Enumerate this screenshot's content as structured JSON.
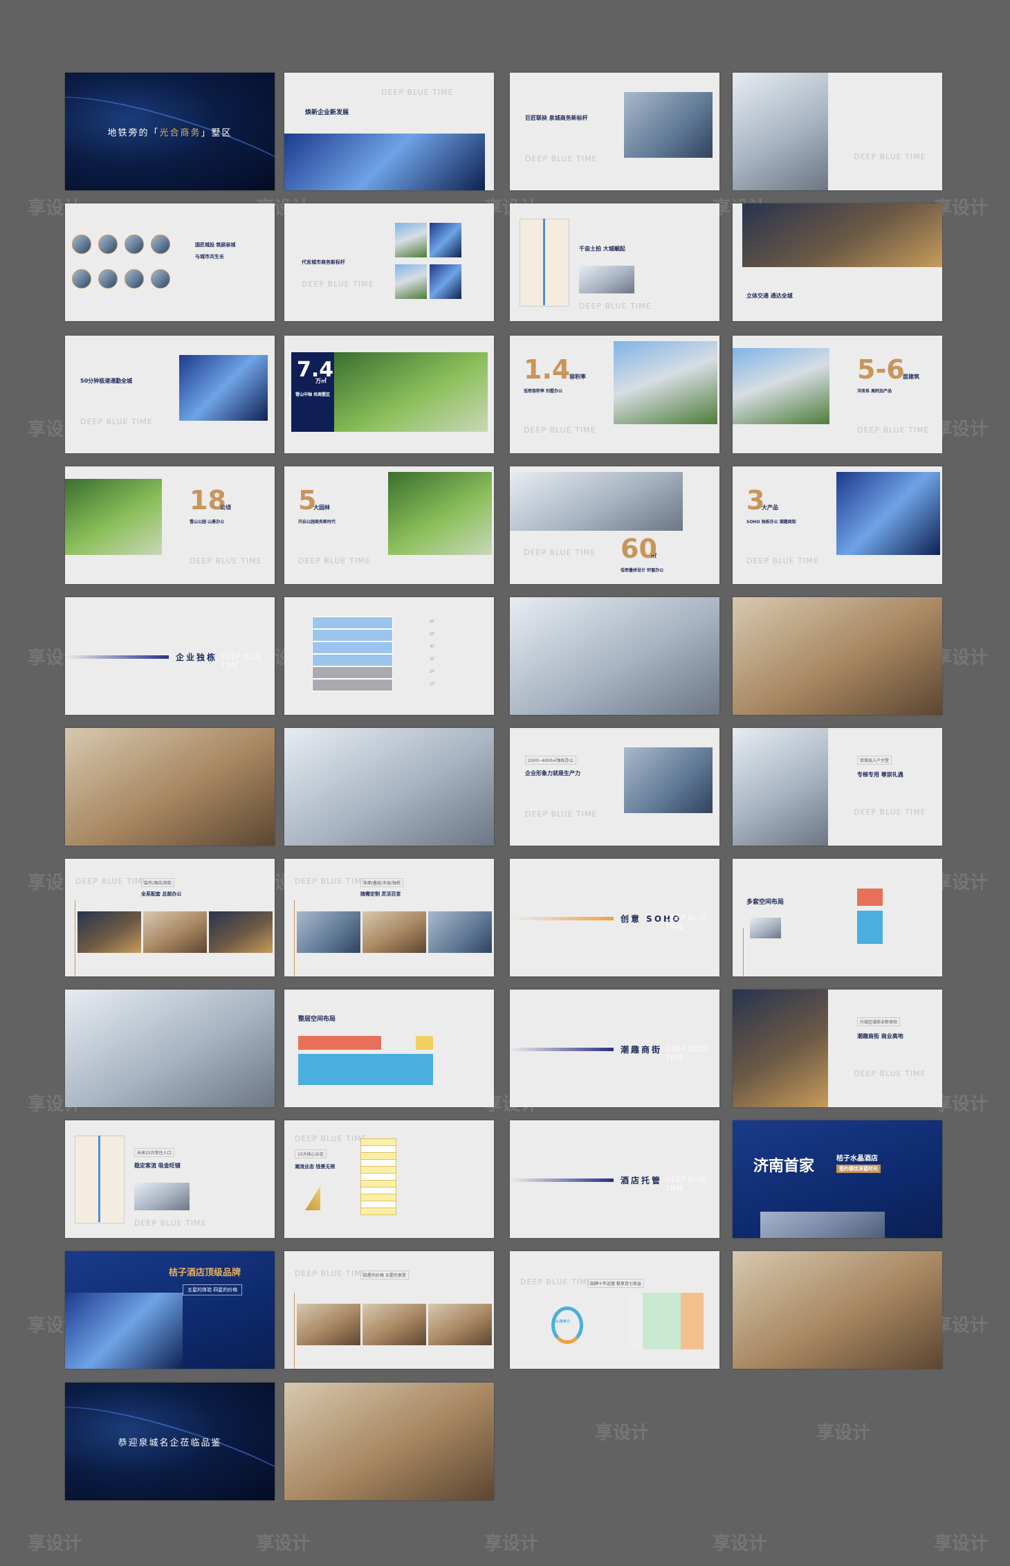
{
  "watermark": "享设计",
  "ghost_text": "DEEP BLUE TIME",
  "colors": {
    "background": "#626262",
    "navy": "#1d2a5a",
    "gold": "#c8955a",
    "orange": "#f0a040",
    "coral": "#e8705a",
    "sky": "#4aaee0",
    "yellow": "#f0d060"
  },
  "slides": [
    {
      "kind": "dark-title",
      "title_pre": "地铁旁的「",
      "title_gold": "光合商务",
      "title_post": "」墅区"
    },
    {
      "kind": "text-photo-bottom",
      "head": "焕新企业新发展",
      "photo": "p0"
    },
    {
      "kind": "text-photo-right",
      "head": "巨匠联袂 泉城商务新标杆",
      "photo": "p1"
    },
    {
      "kind": "photo-left-text",
      "head": "",
      "photo": "p4"
    },
    {
      "kind": "circles",
      "head": "国匠城投 筑耕泉城",
      "sub": "与城市共生长"
    },
    {
      "kind": "text-photo-grid",
      "head": "代言城市商务新标杆",
      "photo": "p1"
    },
    {
      "kind": "map-text",
      "head": "千亩土拍 大城崛起"
    },
    {
      "kind": "photo-top-text",
      "head": "立体交通 通达全城",
      "photo": "p5"
    },
    {
      "kind": "text-photo-right",
      "head": "50分钟极速通勤全城",
      "photo": "p0"
    },
    {
      "kind": "stat-navy",
      "big": "7.4",
      "unit": "万㎡",
      "head": "雪山中轴 尚商墅区",
      "photo": "p6"
    },
    {
      "kind": "stat",
      "big": "1.4",
      "unit": "容积率",
      "head": "低密容积率 别墅办公",
      "photo": "p2",
      "side": "right"
    },
    {
      "kind": "stat",
      "big": "5-6",
      "unit": "层建筑",
      "head": "洋房系 高附加产品",
      "photo": "p2",
      "side": "left"
    },
    {
      "kind": "stat",
      "big": "18",
      "unit": "公顷",
      "head": "雪山公园 山景办公",
      "photo": "p6",
      "side": "left"
    },
    {
      "kind": "stat",
      "big": "5",
      "unit": "大园林",
      "head": "开启公园商务新时代",
      "photo": "p6",
      "side": "right"
    },
    {
      "kind": "stat",
      "big": "60",
      "unit": "㎡",
      "head": "低密叠拼设计 轩窗办公",
      "photo": "p4",
      "side": "top"
    },
    {
      "kind": "stat",
      "big": "3",
      "unit": "大产品",
      "head": "SOHO  独栋办公  潮趣商街",
      "photo": "p0",
      "side": "right"
    },
    {
      "kind": "section",
      "head": "企业独栋",
      "bar": "navy"
    },
    {
      "kind": "floors",
      "floors": [
        "6F",
        "5F",
        "4F",
        "3F",
        "2F",
        "1F"
      ]
    },
    {
      "kind": "photo",
      "photo": "p4"
    },
    {
      "kind": "photo",
      "photo": "p3"
    },
    {
      "kind": "photo",
      "photo": "p3"
    },
    {
      "kind": "photo",
      "photo": "p4"
    },
    {
      "kind": "text-photo-right",
      "tag": "2000~4000㎡独栋办公",
      "head": "企业形象力就是生产力",
      "photo": "p1"
    },
    {
      "kind": "photo-left-text",
      "tag": "双首层入户大堂",
      "head": "专梯专用 尊崇礼遇",
      "photo": "p4"
    },
    {
      "kind": "text-photo-strip",
      "tag": "会所/酒店/商街",
      "head": "全系配套 总部办公",
      "photo": "p5"
    },
    {
      "kind": "text-photo-strip",
      "tag": "多面/叠层/多层/独栋",
      "head": "随需定制 灵活百变",
      "photo": "p1"
    },
    {
      "kind": "section",
      "head": "创意 SOHO",
      "bar": "orange"
    },
    {
      "kind": "plan-small",
      "head": "多套空间布局"
    },
    {
      "kind": "photo",
      "photo": "p4"
    },
    {
      "kind": "plan-wide",
      "head": "整层空间布局"
    },
    {
      "kind": "section",
      "head": "潮趣商街",
      "bar": "navy"
    },
    {
      "kind": "photo-left-text",
      "tag": "升级区域商业新体验",
      "head": "潮趣商街 商业高地",
      "photo": "p5"
    },
    {
      "kind": "map-text",
      "tag": "未来25万常住人口",
      "head": "稳定客流 吸金旺铺"
    },
    {
      "kind": "table-text",
      "tag": "10大核心业态",
      "head": "潮流业态 钱景无限"
    },
    {
      "kind": "section",
      "head": "酒店托管",
      "bar": "navy"
    },
    {
      "kind": "hotel-dark",
      "big_title": "济南首家",
      "gold": "桔子水晶酒店",
      "badge": "签约德佳深蓝时光"
    },
    {
      "kind": "hotel-navy",
      "gold": "桔子酒店顶级品牌",
      "badge": "五星的体验 四星的价格"
    },
    {
      "kind": "text-photo-strip",
      "tag": "四星的价格 五星的享受",
      "head": "",
      "photo": "p3"
    },
    {
      "kind": "chart-text",
      "tag": "品牌十年运营 稳享百七收益",
      "head": "",
      "center": "核心竞争力"
    },
    {
      "kind": "photo",
      "photo": "p3"
    },
    {
      "kind": "dark-title",
      "title_pre": "恭迎泉城名企莅临品鉴",
      "title_gold": "",
      "title_post": ""
    },
    {
      "kind": "photo",
      "photo": "p3"
    }
  ]
}
